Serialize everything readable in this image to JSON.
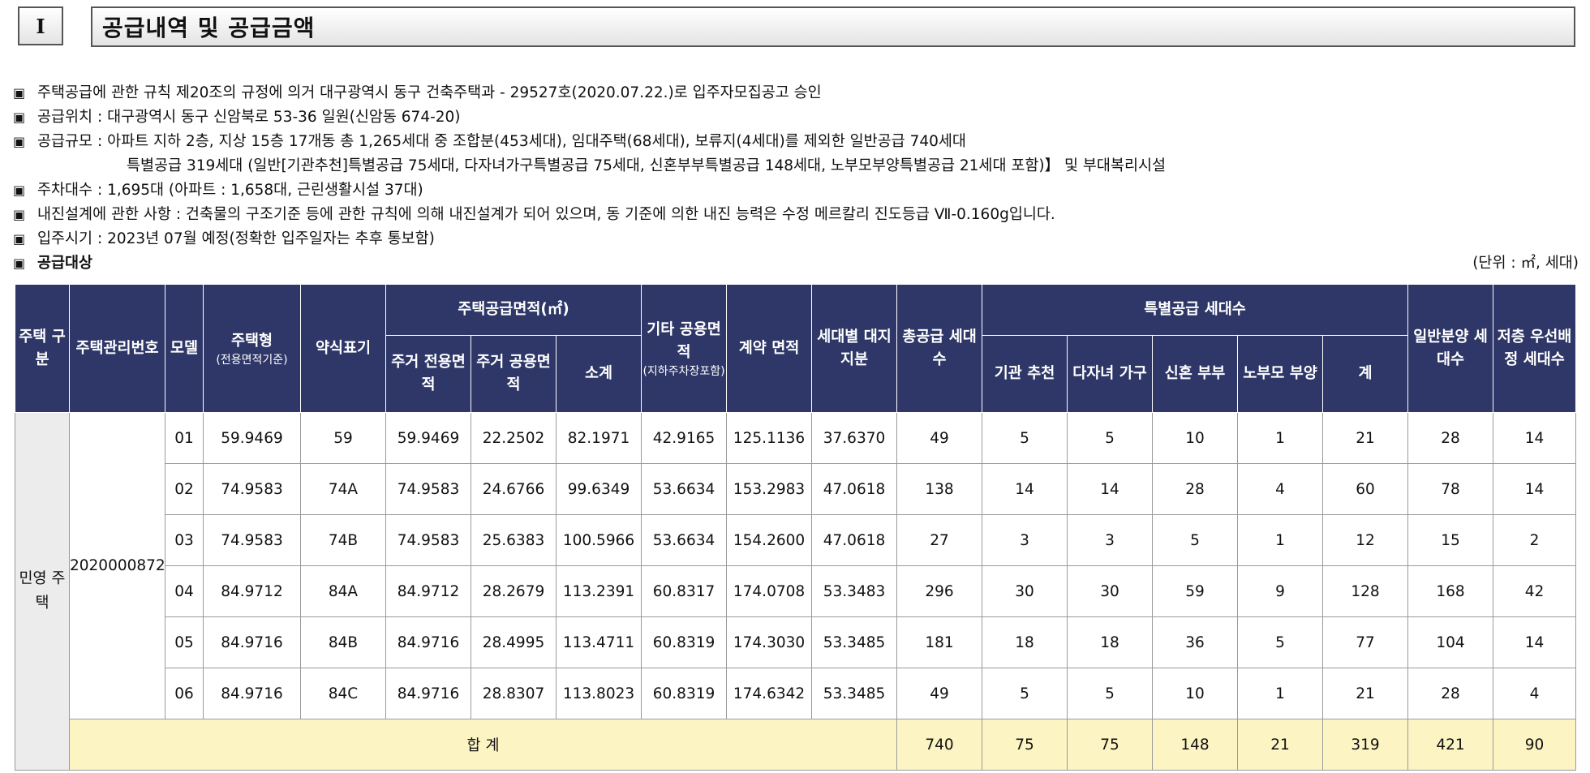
{
  "section": {
    "number": "Ⅰ",
    "title": "공급내역 및 공급금액"
  },
  "notes": [
    "주택공급에 관한 규칙 제20조의 규정에 의거 대구광역시 동구 건축주택과 - 29527호(2020.07.22.)로 입주자모집공고 승인",
    "공급위치 : 대구광역시 동구 신암북로 53-36 일원(신암동 674-20)",
    "공급규모 : 아파트 지하 2층, 지상 15층 17개동 총 1,265세대 중 조합분(453세대), 임대주택(68세대), 보류지(4세대)를 제외한 일반공급 740세대",
    "특별공급 319세대 (일반[기관추천]특별공급 75세대, 다자녀가구특별공급 75세대, 신혼부부특별공급 148세대, 노부모부양특별공급 21세대 포함)】 및 부대복리시설",
    "주차대수 : 1,695대 (아파트 : 1,658대, 근린생활시설 37대)",
    "내진설계에 관한 사항 : 건축물의 구조기준 등에 관한 규칙에 의해 내진설계가 되어 있으며, 동 기준에 의한 내진 능력은 수정 메르칼리 진도등급 Ⅶ-0.160g입니다.",
    "입주시기 : 2023년 07월 예정(정확한 입주일자는 추후 통보함)"
  ],
  "target_heading": "공급대상",
  "unit_note": "(단위 : ㎡, 세대)",
  "table": {
    "headers": {
      "housing_type": "주택 구분",
      "mgmt_no": "주택관리번호",
      "model": "모델",
      "house_type": "주택형",
      "house_type_sub": "(전용면적기준)",
      "short_name": "약식표기",
      "supply_area": "주택공급면적(㎡)",
      "exclusive_area": "주거 전용면적",
      "common_area": "주거 공용면적",
      "subtotal": "소계",
      "other_common": "기타 공용면적",
      "other_common_sub": "(지하주차장포함)",
      "contract_area": "계약 면적",
      "land_share": "세대별 대지지분",
      "total_units": "총공급 세대수",
      "special_units": "특별공급 세대수",
      "institution": "기관 추천",
      "multichild": "다자녀 가구",
      "newlywed": "신혼 부부",
      "elderly": "노부모 부양",
      "special_sum": "계",
      "general_units": "일반분양 세대수",
      "low_floor": "저층 우선배정 세대수"
    },
    "category": "민영 주택",
    "mgmt_number": "2020000872",
    "rows": [
      {
        "model": "01",
        "house_type": "59.9469",
        "short": "59",
        "exclusive": "59.9469",
        "common": "22.2502",
        "subtotal": "82.1971",
        "other": "42.9165",
        "contract": "125.1136",
        "land": "37.6370",
        "total": "49",
        "inst": "5",
        "multi": "5",
        "newly": "10",
        "elder": "1",
        "sp_sum": "21",
        "general": "28",
        "low": "14"
      },
      {
        "model": "02",
        "house_type": "74.9583",
        "short": "74A",
        "exclusive": "74.9583",
        "common": "24.6766",
        "subtotal": "99.6349",
        "other": "53.6634",
        "contract": "153.2983",
        "land": "47.0618",
        "total": "138",
        "inst": "14",
        "multi": "14",
        "newly": "28",
        "elder": "4",
        "sp_sum": "60",
        "general": "78",
        "low": "14"
      },
      {
        "model": "03",
        "house_type": "74.9583",
        "short": "74B",
        "exclusive": "74.9583",
        "common": "25.6383",
        "subtotal": "100.5966",
        "other": "53.6634",
        "contract": "154.2600",
        "land": "47.0618",
        "total": "27",
        "inst": "3",
        "multi": "3",
        "newly": "5",
        "elder": "1",
        "sp_sum": "12",
        "general": "15",
        "low": "2"
      },
      {
        "model": "04",
        "house_type": "84.9712",
        "short": "84A",
        "exclusive": "84.9712",
        "common": "28.2679",
        "subtotal": "113.2391",
        "other": "60.8317",
        "contract": "174.0708",
        "land": "53.3483",
        "total": "296",
        "inst": "30",
        "multi": "30",
        "newly": "59",
        "elder": "9",
        "sp_sum": "128",
        "general": "168",
        "low": "42"
      },
      {
        "model": "05",
        "house_type": "84.9716",
        "short": "84B",
        "exclusive": "84.9716",
        "common": "28.4995",
        "subtotal": "113.4711",
        "other": "60.8319",
        "contract": "174.3030",
        "land": "53.3485",
        "total": "181",
        "inst": "18",
        "multi": "18",
        "newly": "36",
        "elder": "5",
        "sp_sum": "77",
        "general": "104",
        "low": "14"
      },
      {
        "model": "06",
        "house_type": "84.9716",
        "short": "84C",
        "exclusive": "84.9716",
        "common": "28.8307",
        "subtotal": "113.8023",
        "other": "60.8319",
        "contract": "174.6342",
        "land": "53.3485",
        "total": "49",
        "inst": "5",
        "multi": "5",
        "newly": "10",
        "elder": "1",
        "sp_sum": "21",
        "general": "28",
        "low": "4"
      }
    ],
    "totals": {
      "label": "합 계",
      "total": "740",
      "inst": "75",
      "multi": "75",
      "newly": "148",
      "elder": "21",
      "sp_sum": "319",
      "general": "421",
      "low": "90"
    }
  }
}
